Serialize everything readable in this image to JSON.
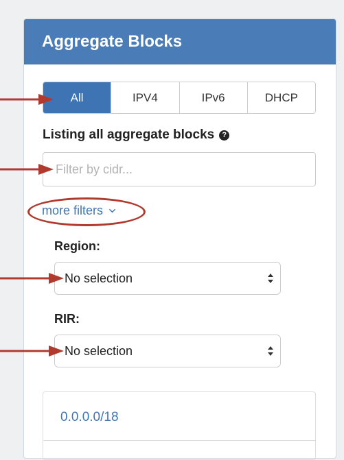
{
  "panel": {
    "title": "Aggregate Blocks"
  },
  "tabs": [
    {
      "label": "All",
      "active": true
    },
    {
      "label": "IPV4",
      "active": false
    },
    {
      "label": "IPv6",
      "active": false
    },
    {
      "label": "DHCP",
      "active": false
    }
  ],
  "listing": {
    "text": "Listing all aggregate blocks"
  },
  "filter": {
    "placeholder": "Filter by cidr...",
    "value": ""
  },
  "more_filters": {
    "label": "more filters"
  },
  "region": {
    "label": "Region:",
    "selected": "No selection"
  },
  "rir": {
    "label": "RIR:",
    "selected": "No selection"
  },
  "results": [
    {
      "cidr": "0.0.0.0/18"
    }
  ],
  "colors": {
    "header": "#4a7db8",
    "active_tab": "#3e74b4",
    "link": "#3f76b5",
    "annotation": "#b03a2e"
  },
  "icons": [
    "help-icon",
    "chevron-down-icon",
    "select-updown-icon",
    "annotation-arrow"
  ]
}
